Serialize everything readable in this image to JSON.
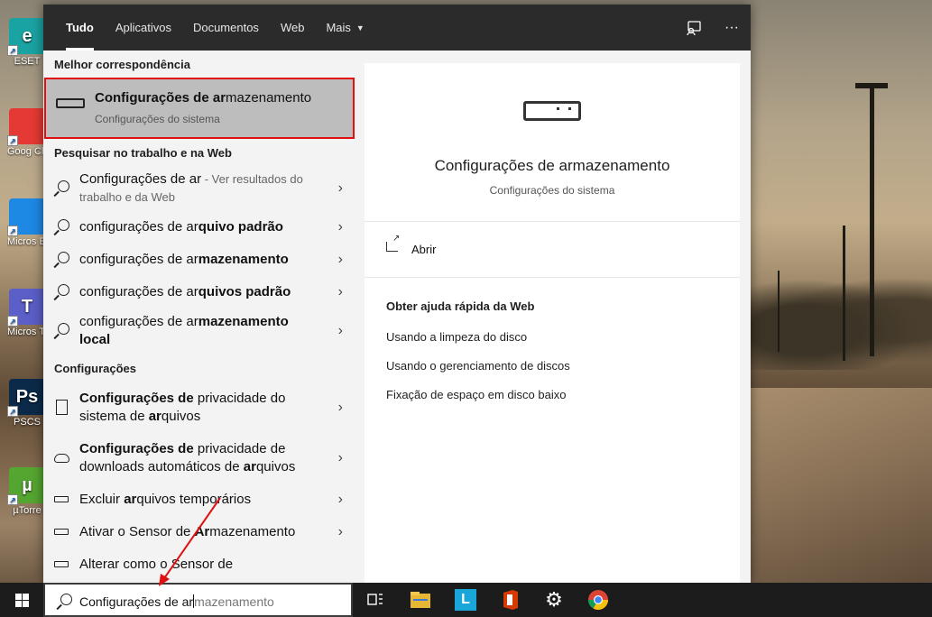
{
  "desktop": {
    "icons": [
      {
        "label": "ESET",
        "icon": "eset-icon",
        "color": "#1aa3a3",
        "glyph": "e"
      },
      {
        "label": "Goog Chrom",
        "icon": "chrome-icon",
        "color": "#e53935",
        "glyph": ""
      },
      {
        "label": "Micros Edge",
        "icon": "edge-icon",
        "color": "#1e88e5",
        "glyph": ""
      },
      {
        "label": "Micros Team",
        "icon": "teams-icon",
        "color": "#5b5fc7",
        "glyph": "T"
      },
      {
        "label": "PSCS",
        "icon": "photoshop-icon",
        "color": "#0b2a4a",
        "glyph": "Ps"
      },
      {
        "label": "µTorre",
        "icon": "utorrent-icon",
        "color": "#55a630",
        "glyph": "µ"
      }
    ]
  },
  "search_panel": {
    "tabs": [
      {
        "label": "Tudo",
        "active": true
      },
      {
        "label": "Aplicativos",
        "active": false
      },
      {
        "label": "Documentos",
        "active": false
      },
      {
        "label": "Web",
        "active": false
      },
      {
        "label": "Mais",
        "active": false,
        "dropdown": true
      }
    ],
    "top_actions": [
      {
        "icon": "feedback-icon"
      },
      {
        "icon": "more-options-icon",
        "glyph": "···"
      }
    ],
    "best_match": {
      "header": "Melhor correspondência",
      "title_bold": "Configurações de ar",
      "title_rest": "mazenamento",
      "subtitle": "Configurações do sistema"
    },
    "web_section": {
      "header": "Pesquisar no trabalho e na Web",
      "items": [
        {
          "prefix": "Configurações de ar",
          "bold": "",
          "suffix": " - Ver resultados do trabalho e da Web"
        },
        {
          "prefix": "configurações de ar",
          "bold": "quivo padrão",
          "suffix": ""
        },
        {
          "prefix": "configurações de ar",
          "bold": "mazenamento",
          "suffix": ""
        },
        {
          "prefix": "configurações de ar",
          "bold": "quivos padrão",
          "suffix": ""
        },
        {
          "prefix": "configurações de ar",
          "bold": "mazenamento local",
          "suffix": ""
        }
      ]
    },
    "settings_section": {
      "header": "Configurações",
      "items": [
        {
          "icon": "document-icon",
          "html": [
            "b:Configurações de",
            " privacidade do sistema de ",
            "b:ar",
            "quivos"
          ]
        },
        {
          "icon": "cloud-icon",
          "html": [
            "b:Configurações de",
            " privacidade de downloads automáticos de ",
            "b:ar",
            "quivos"
          ]
        },
        {
          "icon": "drive-icon",
          "html": [
            "Excluir ",
            "b:ar",
            "quivos temporários"
          ]
        },
        {
          "icon": "drive-icon",
          "html": [
            "Ativar o Sensor de ",
            "b:Ar",
            "mazenamento"
          ]
        },
        {
          "icon": "drive-icon",
          "html": [
            "Alterar como o Sensor de"
          ]
        }
      ]
    },
    "preview": {
      "title": "Configurações de armazenamento",
      "subtitle": "Configurações do sistema",
      "open_label": "Abrir",
      "help_title": "Obter ajuda rápida da Web",
      "help_links": [
        "Usando a limpeza do disco",
        "Usando o gerenciamento de discos",
        "Fixação de espaço em disco baixo"
      ]
    }
  },
  "taskbar": {
    "search_typed": "Configurações de ar",
    "search_ghost": "mazenamento",
    "apps": [
      {
        "icon": "task-view-icon"
      },
      {
        "icon": "file-explorer-icon"
      },
      {
        "icon": "l-app-icon",
        "glyph": "L"
      },
      {
        "icon": "office-icon"
      },
      {
        "icon": "settings-gear-icon",
        "glyph": "⚙"
      },
      {
        "icon": "chrome-taskbar-icon"
      }
    ]
  },
  "colors": {
    "highlight_border": "#e01010",
    "best_match_bg": "#bdbdbd",
    "topbar_bg": "#2b2b2b",
    "annotation_arrow": "#e01010"
  }
}
